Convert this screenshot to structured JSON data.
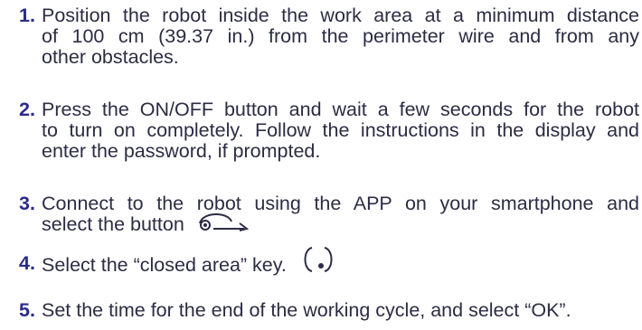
{
  "steps": [
    {
      "number": "1.",
      "lines": [
        "Position the robot inside the work area at a minimum distance",
        "of 100 cm (39.37 in.) from the perimeter wire and from any",
        "other obstacles."
      ]
    },
    {
      "number": "2.",
      "lines": [
        "Press the ON/OFF button and wait a few seconds for the robot",
        "to turn on completely. Follow the instructions in the display and",
        "enter the password, if prompted."
      ]
    },
    {
      "number": "3.",
      "lines": [
        "Connect to the robot using the APP on your smartphone and",
        "select the button"
      ],
      "icon": "return-to-base-icon"
    },
    {
      "number": "4.",
      "lines": [
        "Select the “closed area” key."
      ],
      "icon": "closed-area-key-icon"
    },
    {
      "number": "5.",
      "lines": [
        "Set the time for the end of the working cycle, and select “OK”."
      ]
    }
  ]
}
